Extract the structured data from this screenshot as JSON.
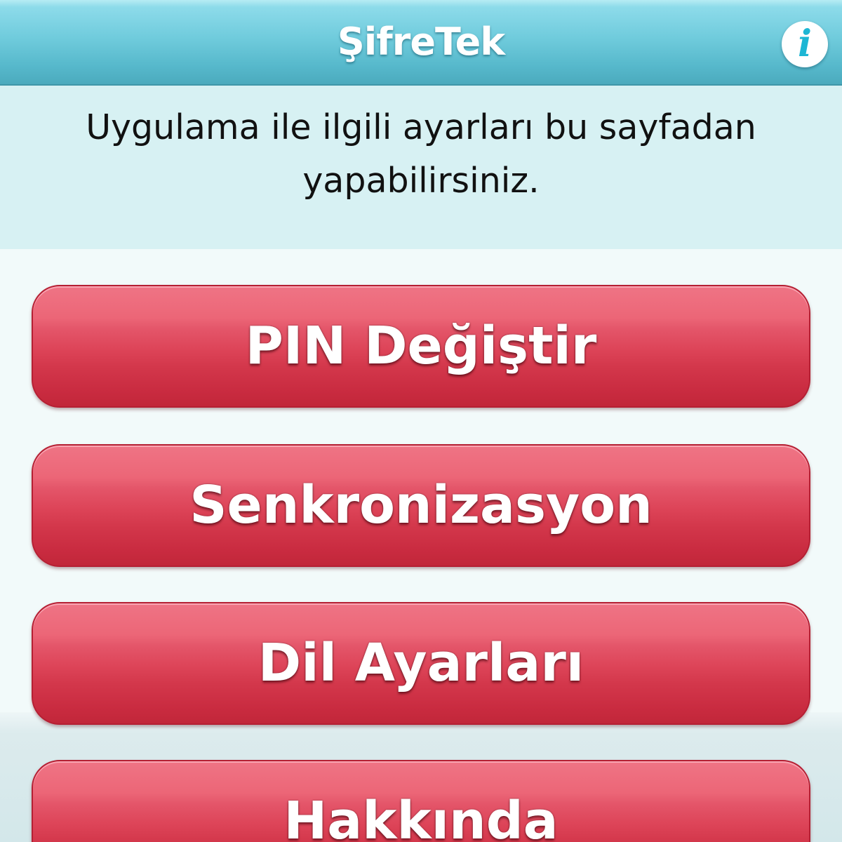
{
  "app": {
    "title": "ŞifreTek",
    "info_icon": "info-icon"
  },
  "description": {
    "text": "Uygulama ile ilgili ayarları bu sayfadan yapabilirsiniz."
  },
  "menu": {
    "items": [
      {
        "label": "PIN Değiştir"
      },
      {
        "label": "Senkronizasyon"
      },
      {
        "label": "Dil Ayarları"
      },
      {
        "label": "Hakkında"
      }
    ]
  },
  "colors": {
    "title_bar": "#6fcbdc",
    "button_red": "#dd4458",
    "description_bg": "#d7f1f3",
    "info_glyph": "#1db6d4"
  }
}
